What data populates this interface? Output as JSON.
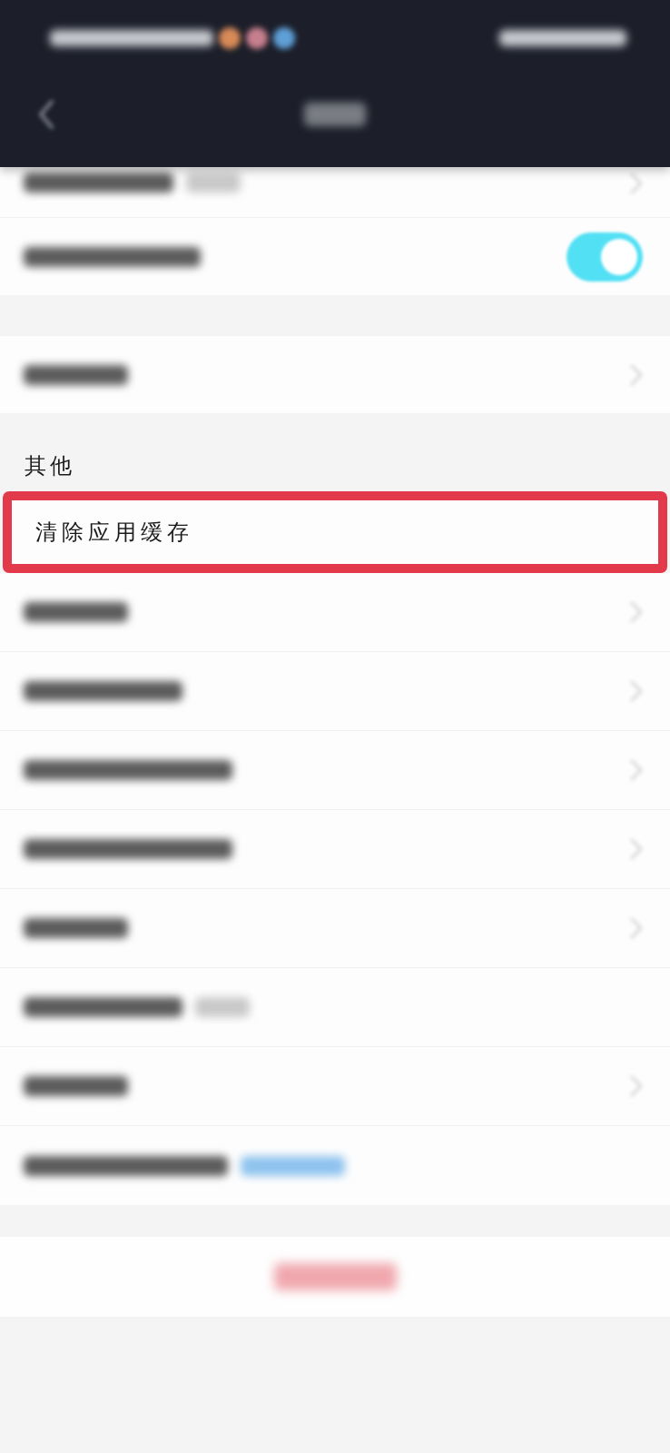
{
  "section_top": {
    "rows": [
      {
        "kind": "chevron_note"
      },
      {
        "kind": "toggle",
        "on": true
      }
    ]
  },
  "section_middle": {
    "rows": [
      {
        "kind": "chevron"
      }
    ]
  },
  "section_other": {
    "title": "其他",
    "rows": [
      {
        "kind": "plain",
        "label": "清除应用缓存",
        "highlighted": true
      },
      {
        "kind": "chevron",
        "highlighted": false
      },
      {
        "kind": "chevron",
        "highlighted": false
      },
      {
        "kind": "chevron",
        "highlighted": false
      },
      {
        "kind": "chevron",
        "highlighted": false
      },
      {
        "kind": "chevron",
        "highlighted": false
      },
      {
        "kind": "note",
        "highlighted": false
      },
      {
        "kind": "chevron",
        "highlighted": false
      },
      {
        "kind": "link",
        "highlighted": false
      }
    ]
  }
}
